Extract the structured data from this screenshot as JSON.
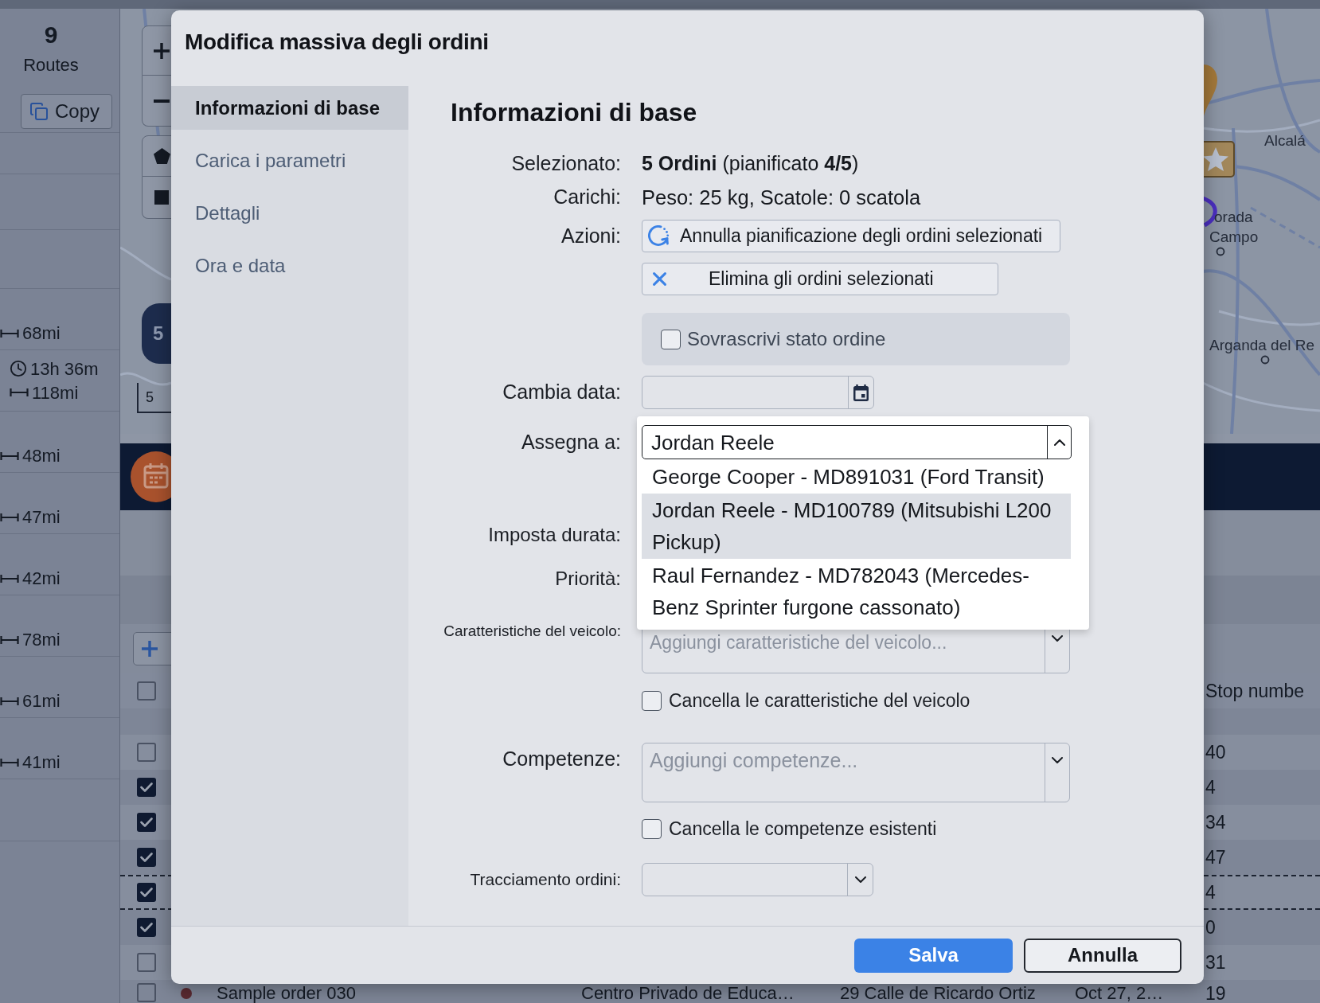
{
  "background": {
    "routes_panel": {
      "count": "9",
      "label": "Routes",
      "copy_button": "Copy",
      "routes": [
        {
          "distance": "68mi"
        },
        {
          "duration": "13h 36m",
          "distance": "118mi"
        },
        {
          "distance": "48mi"
        },
        {
          "distance": "47mi"
        },
        {
          "distance": "42mi"
        },
        {
          "distance": "78mi"
        },
        {
          "distance": "61mi"
        },
        {
          "distance": "41mi"
        }
      ]
    },
    "map": {
      "route_badge": "5",
      "scale": "5",
      "places": [
        "Alcalá",
        "orada",
        "Campo",
        "Arganda del Re"
      ]
    },
    "orders_table": {
      "header": {
        "checked": false,
        "column": "Stop numbe"
      },
      "rows": [
        {
          "checked": false,
          "dashed": false,
          "stop": "40"
        },
        {
          "checked": true,
          "dashed": false,
          "stop": "4"
        },
        {
          "checked": true,
          "dashed": false,
          "stop": "34"
        },
        {
          "checked": true,
          "dashed": false,
          "stop": "47"
        },
        {
          "checked": true,
          "dashed": true,
          "stop": "4"
        },
        {
          "checked": true,
          "dashed": false,
          "stop": "0"
        },
        {
          "checked": false,
          "dashed": false,
          "stop": "31"
        },
        {
          "checked": false,
          "dashed": false,
          "name": "Sample order 030",
          "location": "Centro Privado de Educa…",
          "address": "29 Calle de Ricardo Ortiz",
          "date": "Oct 27, 2…",
          "stop": "19"
        }
      ]
    }
  },
  "dialog": {
    "title": "Modifica massiva degli ordini",
    "nav": [
      {
        "label": "Informazioni di base",
        "selected": true
      },
      {
        "label": "Carica i parametri",
        "selected": false
      },
      {
        "label": "Dettagli",
        "selected": false
      },
      {
        "label": "Ora e data",
        "selected": false
      }
    ],
    "section_title": "Informazioni di base",
    "selected": {
      "label": "Selezionato:",
      "value": "**5 Ordini** (pianificato **4/5**)"
    },
    "loads": {
      "label": "Carichi:",
      "value": "Peso: 25 kg, Scatole: 0 scatola"
    },
    "actions": {
      "label": "Azioni:",
      "buttons": [
        {
          "kind": "unschedule",
          "label": "Annulla pianificazione degli ordini selezionati"
        },
        {
          "kind": "delete",
          "label": "Elimina gli ordini selezionati"
        }
      ]
    },
    "override_status": {
      "label": "Sovrascrivi stato ordine",
      "checked": false
    },
    "change_date": {
      "label": "Cambia data:"
    },
    "assign_to": {
      "label": "Assegna a:",
      "value": "Jordan Reele",
      "expanded": true,
      "options": [
        {
          "label": "George Cooper - MD891031 (Ford Transit)",
          "selected": false
        },
        {
          "label": "Jordan Reele - MD100789 (Mitsubishi L200 Pickup)",
          "selected": true
        },
        {
          "label": "Raul Fernandez - MD782043 (Mercedes-Benz Sprinter furgone cassonato)",
          "selected": false
        }
      ]
    },
    "duration": {
      "label": "Imposta durata:"
    },
    "priority": {
      "label": "Priorità:"
    },
    "vehicle_features": {
      "label": "Caratteristiche del veicolo:",
      "placeholder": "Aggiungi caratteristiche del veicolo...",
      "clear": {
        "label": "Cancella le caratteristiche del veicolo",
        "checked": false
      }
    },
    "skills": {
      "label": "Competenze:",
      "placeholder": "Aggiungi competenze...",
      "clear": {
        "label": "Cancella le competenze esistenti",
        "checked": false
      }
    },
    "order_tracking": {
      "label": "Tracciamento ordini:"
    },
    "buttons": [
      {
        "kind": "primary",
        "label": "Salva"
      },
      {
        "kind": "secondary",
        "label": "Annulla"
      }
    ]
  }
}
